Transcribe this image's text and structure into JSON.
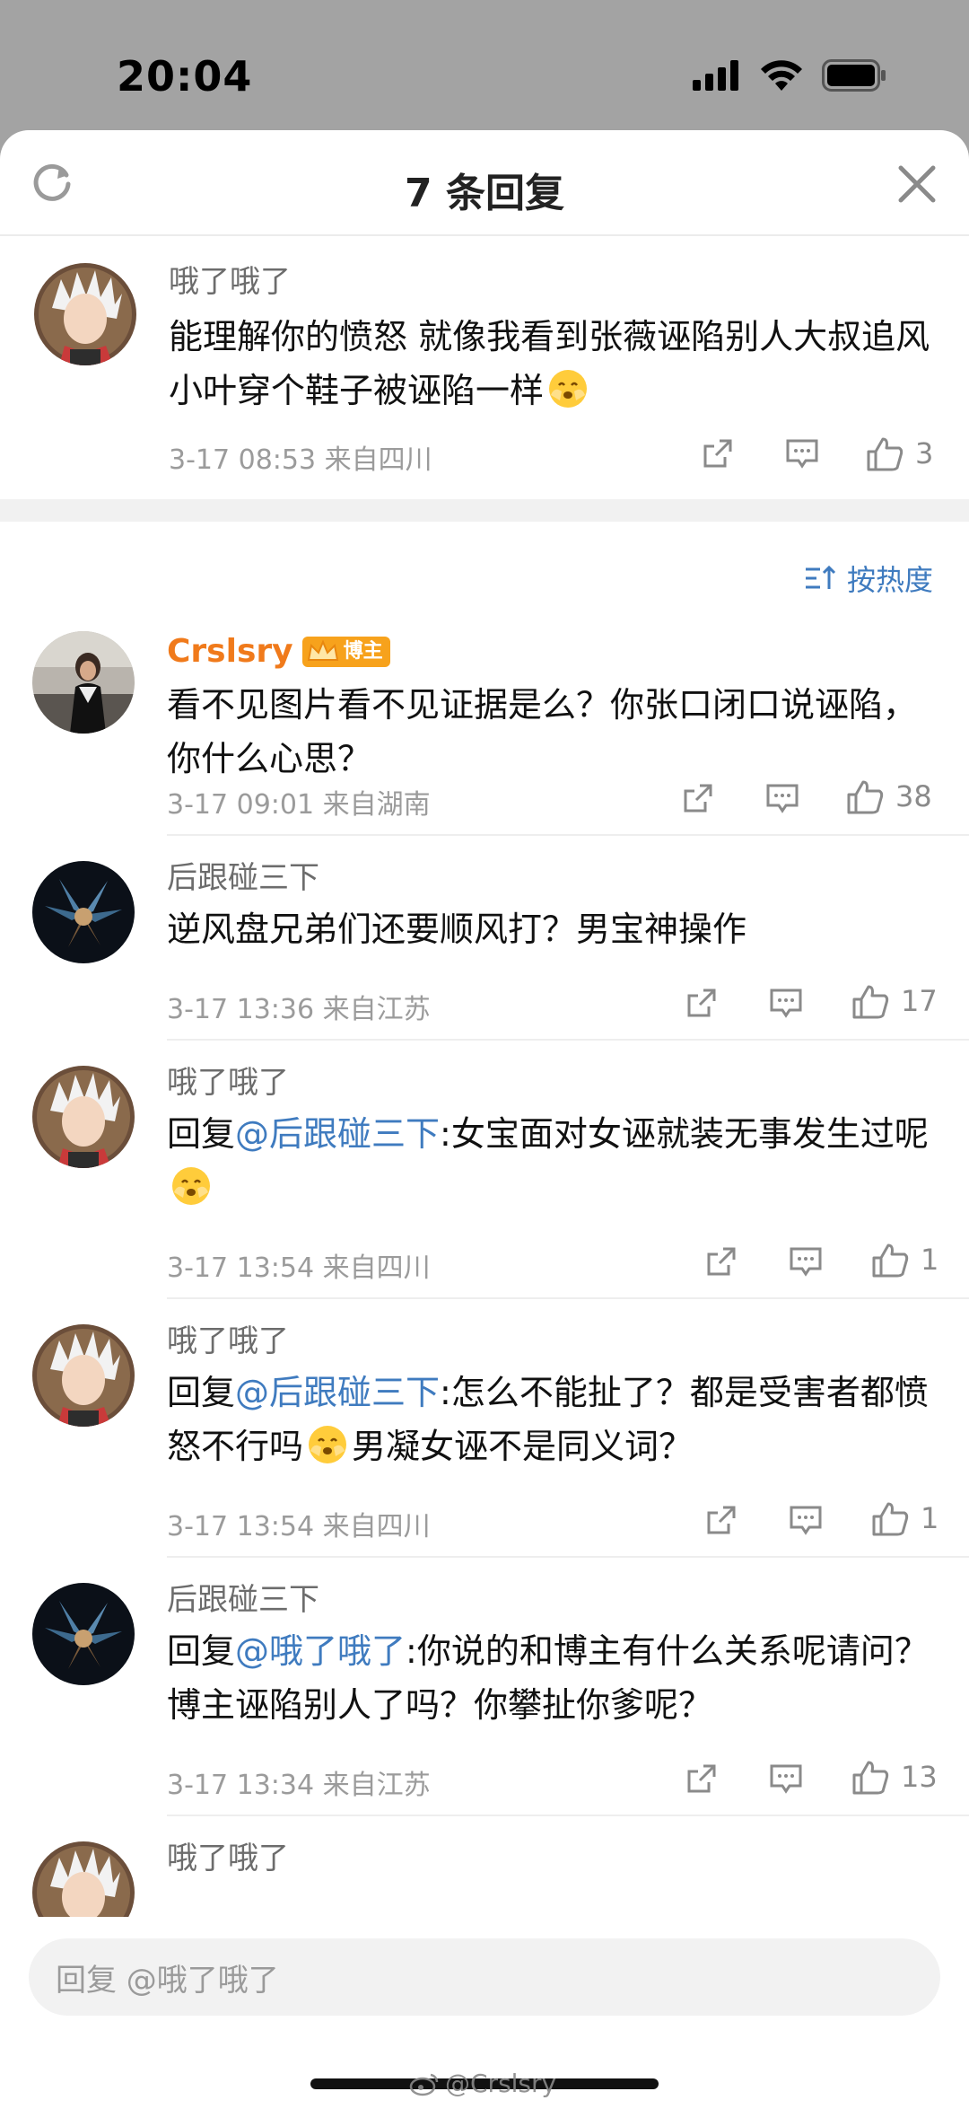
{
  "status_bar": {
    "time": "20:04"
  },
  "header": {
    "title": "7 条回复"
  },
  "root_comment": {
    "user": "哦了哦了",
    "text": "能理解你的愤怒 就像我看到张薇诬陷别人大叔追风小叶穿个鞋子被诬陷一样",
    "time_location": "3-17 08:53  来自四川",
    "likes": "3"
  },
  "sort": {
    "label": "按热度"
  },
  "replies": [
    {
      "user": "Crslsry",
      "badge": "博主",
      "text": "看不见图片看不见证据是么？你张口闭口说诬陷，你什么心思？",
      "time_location": "3-17 09:01  来自湖南",
      "likes": "38"
    },
    {
      "user": "后跟碰三下",
      "text": "逆风盘兄弟们还要顺风打？男宝神操作",
      "time_location": "3-17 13:36  来自江苏",
      "likes": "17"
    },
    {
      "user": "哦了哦了",
      "reply_prefix": "回复",
      "mention": "@后跟碰三下",
      "text": ":女宝面对女诬就装无事发生过呢",
      "time_location": "3-17 13:54  来自四川",
      "likes": "1"
    },
    {
      "user": "哦了哦了",
      "reply_prefix": "回复",
      "mention": "@后跟碰三下",
      "text_a": ":怎么不能扯了？都是受害者都愤怒不行吗",
      "text_b": "男凝女诬不是同义词？",
      "time_location": "3-17 13:54  来自四川",
      "likes": "1"
    },
    {
      "user": "后跟碰三下",
      "reply_prefix": "回复",
      "mention": "@哦了哦了",
      "text": ":你说的和博主有什么关系呢请问？博主诬陷别人了吗？你攀扯你爹呢？",
      "time_location": "3-17 13:34  来自江苏",
      "likes": "13"
    },
    {
      "user": "哦了哦了"
    }
  ],
  "reply_bar": {
    "placeholder": "回复 @哦了哦了"
  },
  "watermark": "@Crslsry",
  "colors": {
    "accent_blue": "#3f7bbf",
    "blogger_orange": "#f07a1b",
    "badge_orange": "#f7a21c"
  },
  "icons": [
    "refresh-icon",
    "close-icon",
    "share-icon",
    "comment-icon",
    "like-icon",
    "sort-icon",
    "blush-emoji",
    "signal-icon",
    "wifi-icon",
    "battery-icon"
  ]
}
